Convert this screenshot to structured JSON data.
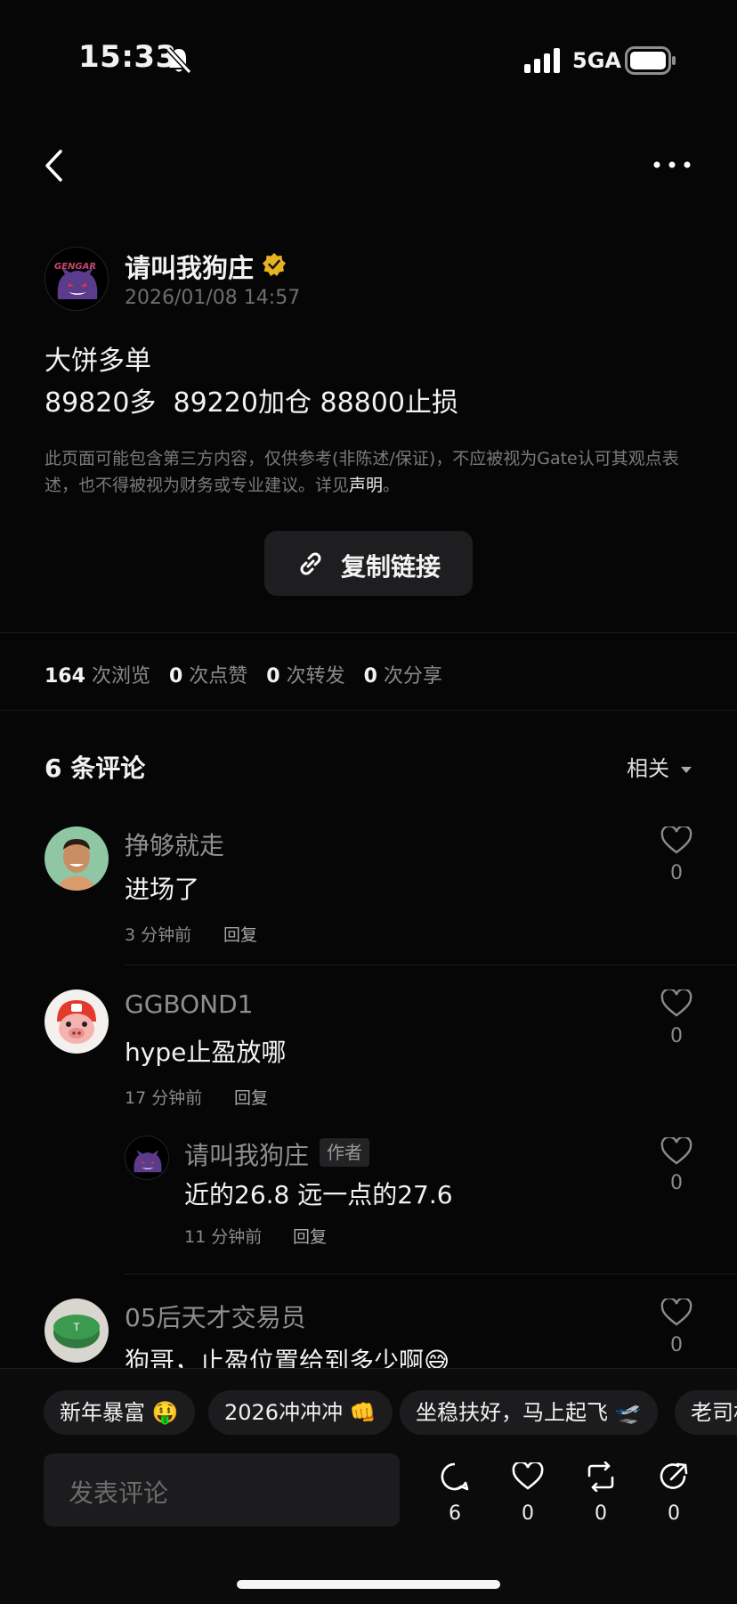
{
  "status_bar": {
    "time": "15:33",
    "network": "5GA"
  },
  "post": {
    "author": "请叫我狗庄",
    "datetime": "2026/01/08 14:57",
    "avatar_text": "GENGAR",
    "line1": "大饼多单",
    "line2": "89820多  89220加仓 88800止损",
    "disclaimer": "此页面可能包含第三方内容，仅供参考(非陈述/保证)，不应被视为Gate认可其观点表述，也不得被视为财务或专业建议。详见",
    "disclaimer_link": "声明",
    "disclaimer_end": "。",
    "copy_link_label": "复制链接"
  },
  "stats": [
    {
      "value": "164",
      "label": "次浏览"
    },
    {
      "value": "0",
      "label": "次点赞"
    },
    {
      "value": "0",
      "label": "次转发"
    },
    {
      "value": "0",
      "label": "次分享"
    }
  ],
  "comments_header": {
    "title": "6 条评论",
    "sort": "相关"
  },
  "comments": [
    {
      "name": "挣够就走",
      "text": "进场了",
      "time": "3 分钟前",
      "reply": "回复",
      "likes": "0"
    },
    {
      "name": "GGBOND1",
      "text": "hype止盈放哪",
      "time": "17 分钟前",
      "reply": "回复",
      "likes": "0"
    },
    {
      "name": "请叫我狗庄",
      "badge": "作者",
      "text": "近的26.8 远一点的27.6",
      "time": "11 分钟前",
      "reply": "回复",
      "likes": "0"
    },
    {
      "name": "05后天才交易员",
      "text": "狗哥，止盈位置给到多少啊😅",
      "likes": "0"
    }
  ],
  "quick_replies": [
    "新年暴富 🤑",
    "2026冲冲冲 👊",
    "坐稳扶好，马上起飞 🛫",
    "老司机"
  ],
  "bottom_bar": {
    "placeholder": "发表评论",
    "comments": "6",
    "likes": "0",
    "reposts": "0",
    "shares": "0"
  }
}
